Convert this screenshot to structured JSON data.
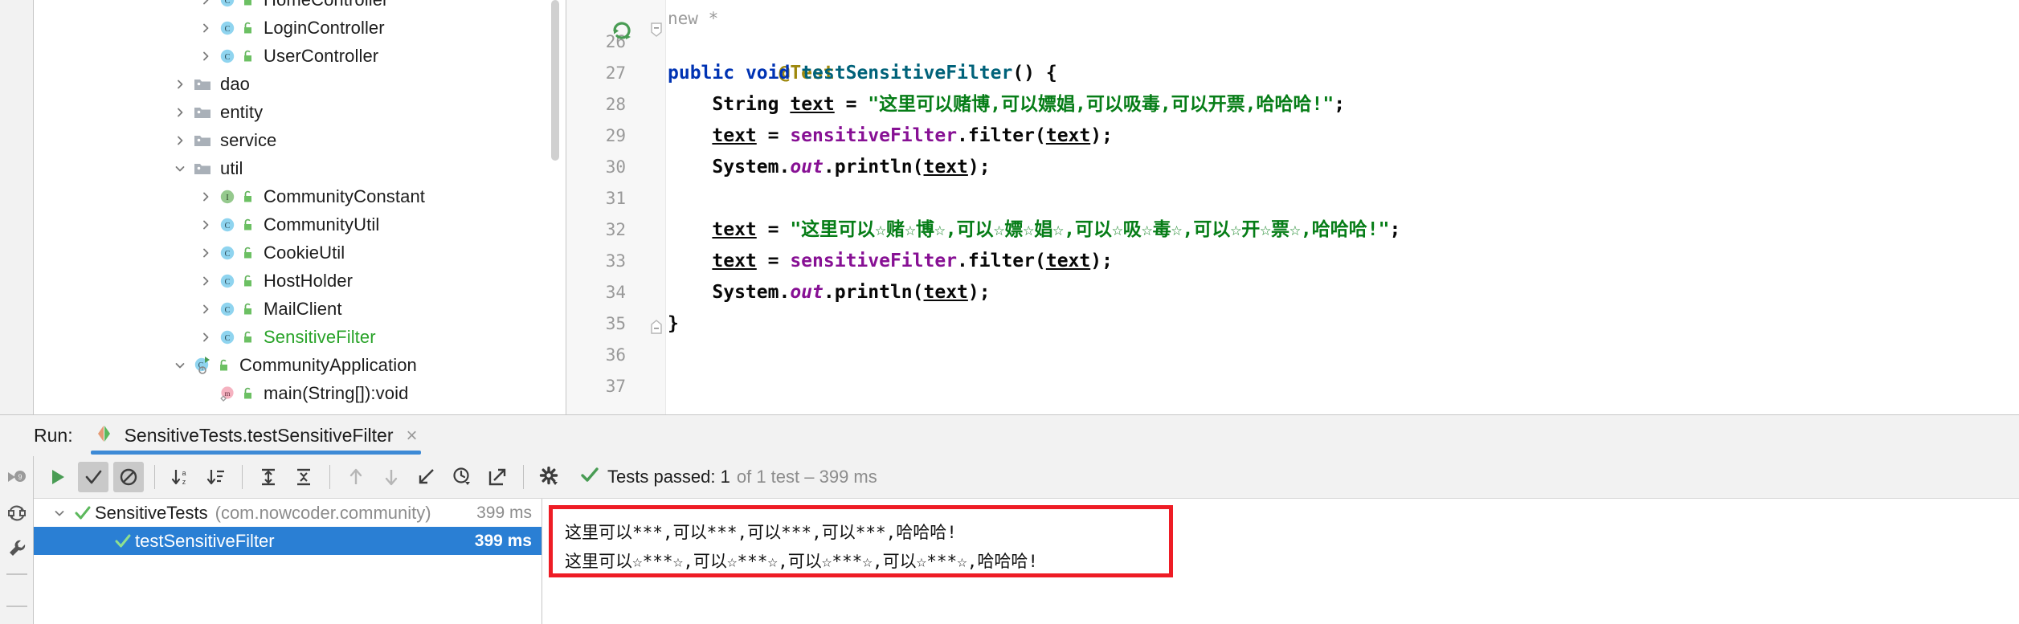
{
  "project_tree": {
    "items": [
      {
        "label": "HomeController",
        "icon": "class-icon",
        "indent": 3,
        "twisty": "collapsed",
        "kind": "class",
        "visibility": "public-lock-icon",
        "color": "normal"
      },
      {
        "label": "LoginController",
        "icon": "class-icon",
        "indent": 3,
        "twisty": "collapsed",
        "kind": "class",
        "visibility": "public-lock-icon",
        "color": "normal"
      },
      {
        "label": "UserController",
        "icon": "class-icon",
        "indent": 3,
        "twisty": "collapsed",
        "kind": "class",
        "visibility": "public-lock-icon",
        "color": "normal"
      },
      {
        "label": "dao",
        "icon": "folder-icon",
        "indent": 2,
        "twisty": "collapsed",
        "kind": "folder",
        "visibility": "",
        "color": "normal"
      },
      {
        "label": "entity",
        "icon": "folder-icon",
        "indent": 2,
        "twisty": "collapsed",
        "kind": "folder",
        "visibility": "",
        "color": "normal"
      },
      {
        "label": "service",
        "icon": "folder-icon",
        "indent": 2,
        "twisty": "collapsed",
        "kind": "folder",
        "visibility": "",
        "color": "normal"
      },
      {
        "label": "util",
        "icon": "folder-icon",
        "indent": 2,
        "twisty": "expanded",
        "kind": "folder",
        "visibility": "",
        "color": "normal"
      },
      {
        "label": "CommunityConstant",
        "icon": "interface-icon",
        "indent": 3,
        "twisty": "collapsed",
        "kind": "interface",
        "visibility": "public-lock-icon",
        "color": "normal"
      },
      {
        "label": "CommunityUtil",
        "icon": "class-icon",
        "indent": 3,
        "twisty": "collapsed",
        "kind": "class",
        "visibility": "public-lock-icon",
        "color": "normal"
      },
      {
        "label": "CookieUtil",
        "icon": "class-icon",
        "indent": 3,
        "twisty": "collapsed",
        "kind": "class",
        "visibility": "public-lock-icon",
        "color": "normal"
      },
      {
        "label": "HostHolder",
        "icon": "class-icon",
        "indent": 3,
        "twisty": "collapsed",
        "kind": "class",
        "visibility": "public-lock-icon",
        "color": "normal"
      },
      {
        "label": "MailClient",
        "icon": "class-icon",
        "indent": 3,
        "twisty": "collapsed",
        "kind": "class",
        "visibility": "public-lock-icon",
        "color": "normal"
      },
      {
        "label": "SensitiveFilter",
        "icon": "class-icon",
        "indent": 3,
        "twisty": "collapsed",
        "kind": "class",
        "visibility": "public-lock-icon",
        "color": "green"
      },
      {
        "label": "CommunityApplication",
        "icon": "runnable-class-icon",
        "indent": 2,
        "twisty": "expanded",
        "kind": "runnable-class",
        "visibility": "public-lock-icon",
        "color": "normal"
      },
      {
        "label": "main(String[]):void",
        "icon": "method-icon",
        "indent": 3,
        "twisty": "none",
        "kind": "method",
        "visibility": "public-lock-icon",
        "color": "normal"
      }
    ]
  },
  "editor": {
    "ghost_hint": "new *",
    "gutter_lines": [
      "26",
      "27",
      "28",
      "29",
      "30",
      "31",
      "32",
      "33",
      "34",
      "35",
      "36",
      "37"
    ],
    "run_gutter_line": "27",
    "fold_marker_line": "35",
    "code": {
      "l26_annotation": "@Test",
      "l27_kw_public": "public",
      "l27_kw_void": "void",
      "l27_method": "testSensitiveFilter",
      "l27_tail": "() {",
      "l28_type": "String",
      "l28_var": "text",
      "l28_eq": " = ",
      "l28_string": "\"这里可以赌博,可以嫖娼,可以吸毒,可以开票,哈哈哈!\"",
      "l28_semi": ";",
      "l29_var": "text",
      "l29_eq": " = ",
      "l29_field": "sensitiveFilter",
      "l29_dot": ".",
      "l29_call": "filter(",
      "l29_arg": "text",
      "l29_tail": ");",
      "l30_sys": "System.",
      "l30_out": "out",
      "l30_println": ".println(",
      "l30_arg": "text",
      "l30_tail": ");",
      "l32_var": "text",
      "l32_eq": " = ",
      "l32_string": "\"这里可以☆赌☆博☆,可以☆嫖☆娼☆,可以☆吸☆毒☆,可以☆开☆票☆,哈哈哈!\"",
      "l32_semi": ";",
      "l33_var": "text",
      "l33_eq": " = ",
      "l33_field": "sensitiveFilter",
      "l33_dot": ".",
      "l33_call": "filter(",
      "l33_arg": "text",
      "l33_tail": ");",
      "l34_sys": "System.",
      "l34_out": "out",
      "l34_println": ".println(",
      "l34_arg": "text",
      "l34_tail": ");",
      "l35_close": "}",
      "l37_close": "}"
    }
  },
  "run_panel": {
    "label": "Run:",
    "tab_title": "SensitiveTests.testSensitiveFilter",
    "tab_close": "×",
    "toolbar": {
      "buttons": [
        {
          "name": "rerun-tests-button",
          "icon": "play-icon"
        },
        {
          "name": "show-passed-toggle",
          "icon": "check-icon",
          "pressed": true
        },
        {
          "name": "show-ignored-toggle",
          "icon": "no-entry-icon",
          "pressed": true
        },
        {
          "name": "sort-alphabetically-button",
          "icon": "sort-alpha-icon"
        },
        {
          "name": "sort-by-duration-button",
          "icon": "sort-duration-icon"
        },
        {
          "name": "expand-all-button",
          "icon": "expand-all-icon"
        },
        {
          "name": "collapse-all-button",
          "icon": "collapse-all-icon"
        },
        {
          "name": "previous-failed-button",
          "icon": "arrow-up-icon"
        },
        {
          "name": "next-failed-button",
          "icon": "arrow-down-icon"
        },
        {
          "name": "scroll-to-source-button",
          "icon": "jump-to-source-icon"
        },
        {
          "name": "test-history-button",
          "icon": "clock-history-icon"
        },
        {
          "name": "export-results-button",
          "icon": "export-icon"
        },
        {
          "name": "settings-button",
          "icon": "gear-icon"
        }
      ],
      "status": {
        "icon": "check-icon",
        "main": "Tests passed: 1",
        "dim": "of 1 test – 399 ms"
      }
    },
    "side_icons": [
      {
        "name": "rerun-failed-icon",
        "icon": "rerun-failed-icon"
      },
      {
        "name": "toggle-auto-test-icon",
        "icon": "refresh-loop-icon"
      },
      {
        "name": "settings-wrench-icon",
        "icon": "wrench-icon"
      }
    ],
    "test_tree": {
      "rows": [
        {
          "name": "SensitiveTests",
          "package": "(com.nowcoder.community)",
          "time": "399 ms",
          "twisty": "expanded",
          "status": "passed",
          "selected": false,
          "indent": 0
        },
        {
          "name": "testSensitiveFilter",
          "package": "",
          "time": "399 ms",
          "twisty": "none",
          "status": "passed",
          "selected": true,
          "indent": 1
        }
      ]
    },
    "console": {
      "lines": [
        "这里可以***,可以***,可以***,可以***,哈哈哈!",
        "这里可以☆***☆,可以☆***☆,可以☆***☆,可以☆***☆,哈哈哈!"
      ],
      "highlight_color": "#ee1c25"
    }
  },
  "colors": {
    "selection_blue": "#2a7fd4",
    "tab_underline": "#3d8ad6",
    "pass_green": "#499c54",
    "class_icon_blue": "#8fd4ef",
    "interface_icon_green": "#95c98d",
    "method_icon_pink": "#f5b2c0",
    "string_green": "#067d17",
    "keyword_blue": "#0033b3",
    "annotation_yellow": "#9e880d",
    "field_purple": "#871094",
    "method_teal": "#00627a"
  }
}
